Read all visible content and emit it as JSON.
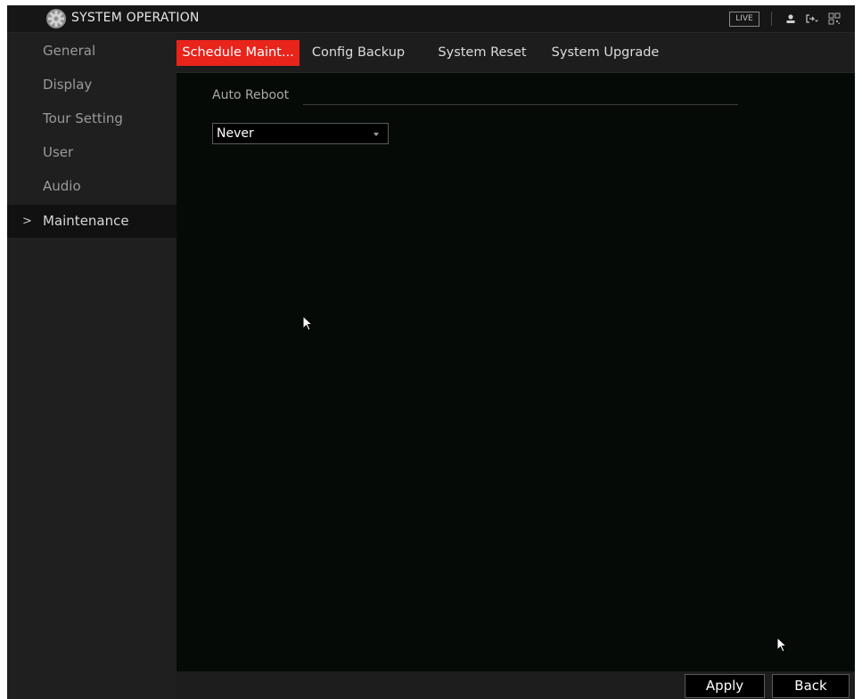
{
  "titlebar": {
    "title": "SYSTEM OPERATION",
    "live_label": "LIVE",
    "icons": [
      "gear-icon",
      "user-icon",
      "logout-icon",
      "qr-code-icon"
    ]
  },
  "sidebar": {
    "items": [
      {
        "label": "General"
      },
      {
        "label": "Display"
      },
      {
        "label": "Tour Setting"
      },
      {
        "label": "User"
      },
      {
        "label": "Audio"
      },
      {
        "label": "Maintenance",
        "active": true,
        "chevron": ">"
      }
    ]
  },
  "tabs": [
    {
      "label": "Schedule Maint...",
      "active": true
    },
    {
      "label": "Config Backup"
    },
    {
      "label": "System Reset"
    },
    {
      "label": "System Upgrade"
    }
  ],
  "main": {
    "section_label": "Auto Reboot",
    "auto_reboot_value": "Never"
  },
  "footer": {
    "apply_label": "Apply",
    "back_label": "Back"
  },
  "colors": {
    "accent": "#e8241b",
    "background": "#060a06",
    "sidebar": "#1f1f1f"
  }
}
